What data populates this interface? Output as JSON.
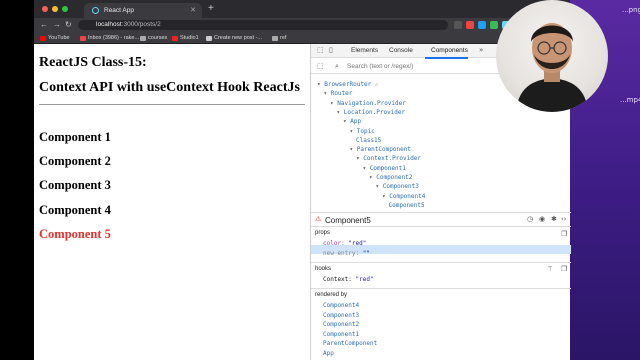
{
  "browser": {
    "tab_title": "React App",
    "url_host": "localhost",
    "url_path": ":3000/posts/2",
    "bookmarks": [
      "YouTube",
      "Inbox (3986) - rake...",
      "courses",
      "Studio1",
      "Create new post -...",
      "ref"
    ]
  },
  "desktop": {
    "label_top": "...png",
    "label_mid": "...mp4"
  },
  "page": {
    "title": "ReactJS Class-15:",
    "subtitle": "Context API with useContext Hook ReactJs",
    "components": [
      "Component 1",
      "Component 2",
      "Component 3",
      "Component 4",
      "Component 5"
    ],
    "active_color": "#e0322f"
  },
  "devtools": {
    "tabs": [
      "Elements",
      "Console",
      "Components"
    ],
    "more_tabs_icon": "chevron-right-double-icon",
    "search_placeholder": "Search (text or /regex/)",
    "tree": [
      {
        "label": "BrowserRouter",
        "depth": 0,
        "warn": "⚠"
      },
      {
        "label": "Router",
        "depth": 1
      },
      {
        "label": "Navigation.Provider",
        "depth": 2
      },
      {
        "label": "Location.Provider",
        "depth": 3
      },
      {
        "label": "App",
        "depth": 4
      },
      {
        "label": "Topic",
        "depth": 5
      },
      {
        "label": "Class15",
        "depth": 6
      },
      {
        "label": "ParentComponent",
        "depth": 5
      },
      {
        "label": "Context.Provider",
        "depth": 6
      },
      {
        "label": "Component1",
        "depth": 7
      },
      {
        "label": "Component2",
        "depth": 8
      },
      {
        "label": "Component3",
        "depth": 9
      },
      {
        "label": "Component4",
        "depth": 10
      },
      {
        "label": "Component5",
        "depth": 11
      }
    ],
    "selected_component": "Component5",
    "props_label": "props",
    "props": [
      {
        "key": "color",
        "value": "\"red\""
      },
      {
        "key": "new entry",
        "value": "\"\""
      }
    ],
    "hooks_label": "hooks",
    "hooks": [
      {
        "key": "Context",
        "value": "\"red\""
      }
    ],
    "rendered_by_label": "rendered by",
    "rendered_by": [
      "Component4",
      "Component3",
      "Component2",
      "Component1",
      "ParentComponent",
      "App",
      "createRoot()"
    ]
  }
}
